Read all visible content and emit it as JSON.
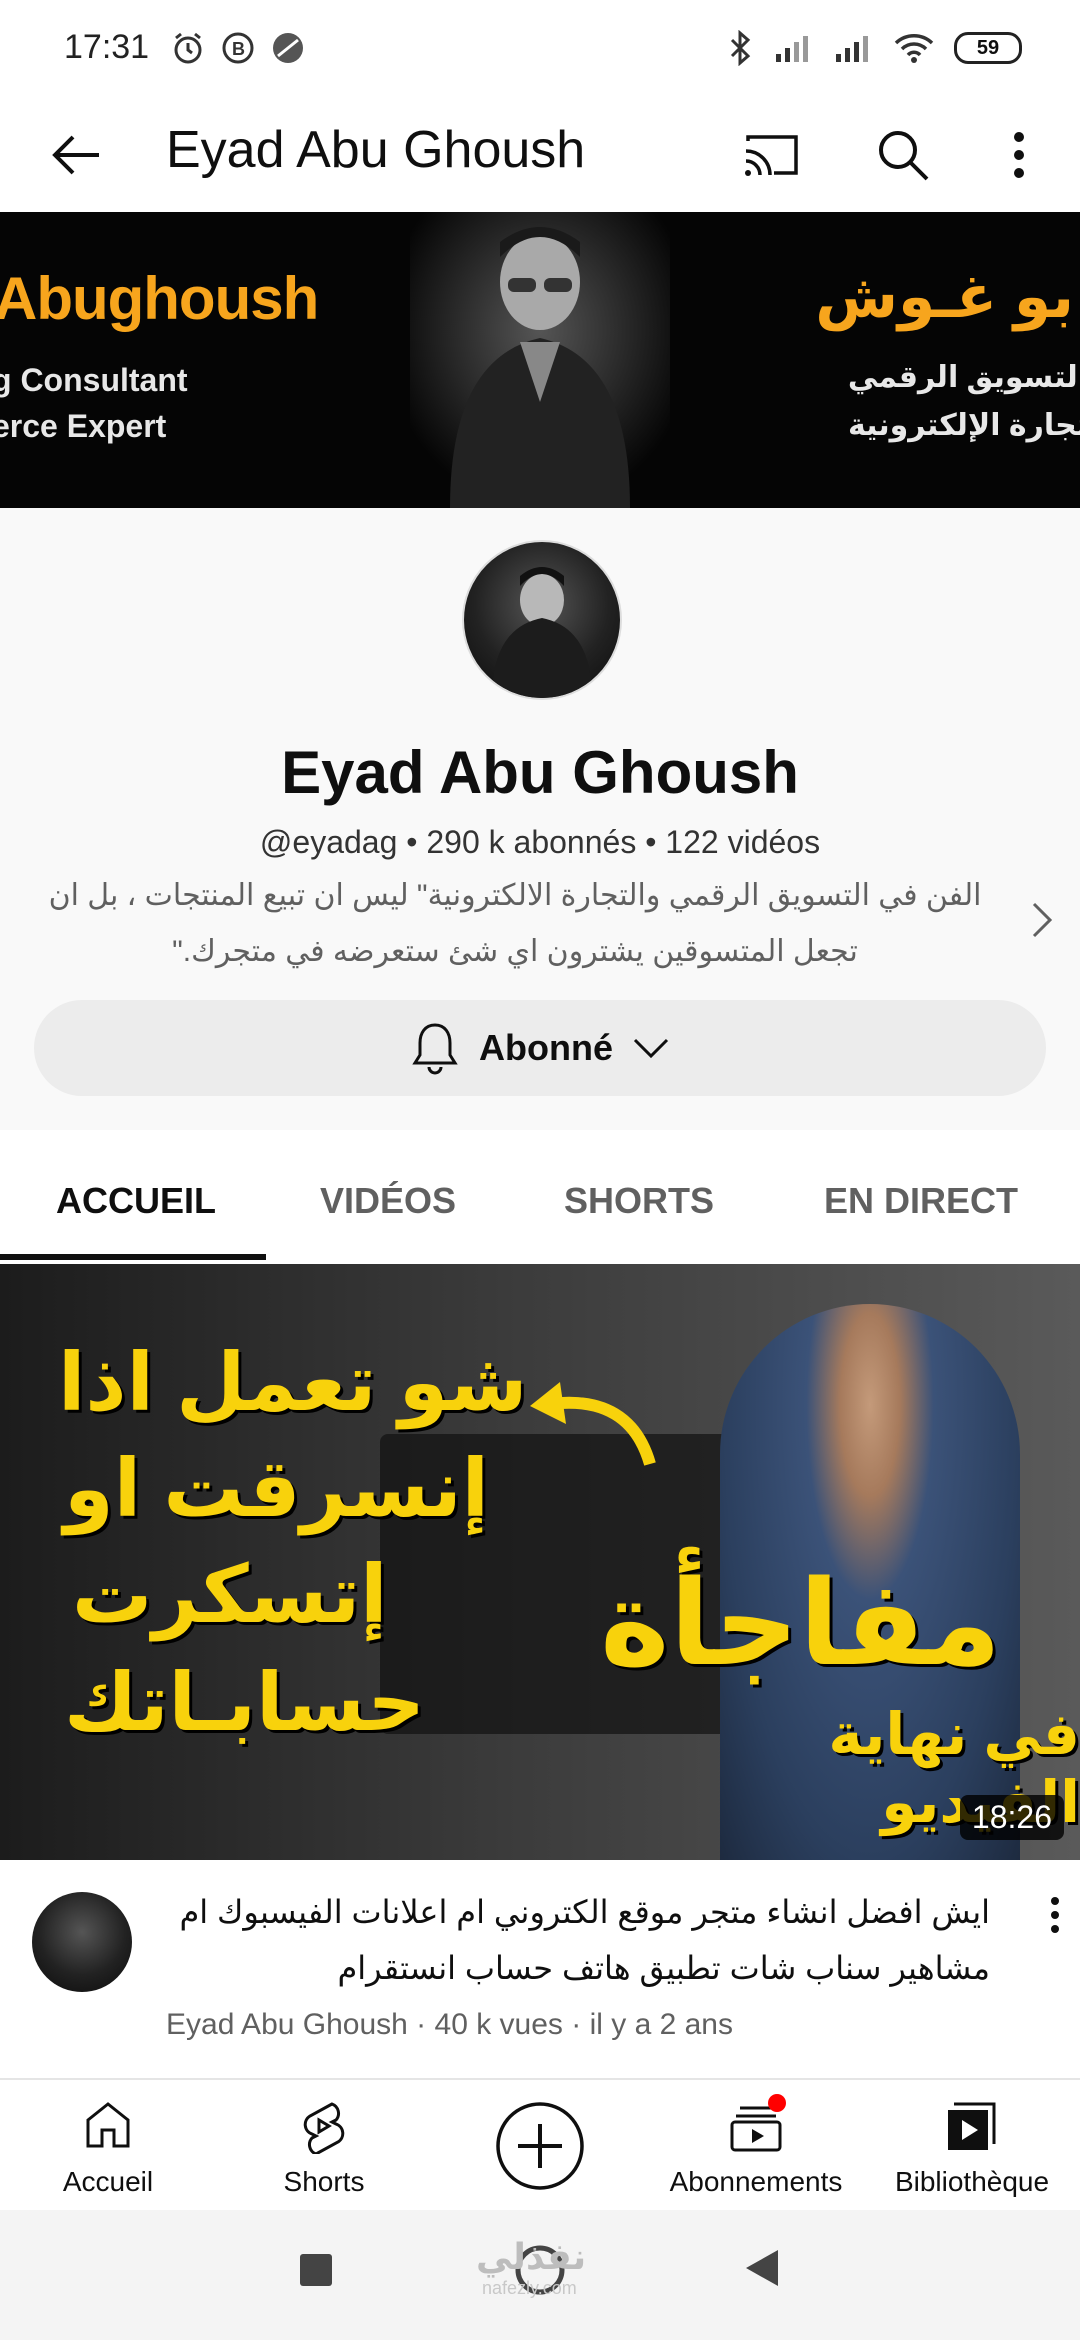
{
  "status_bar": {
    "time": "17:31",
    "battery": "59"
  },
  "top_bar": {
    "title": "Eyad Abu Ghoush"
  },
  "banner": {
    "en_name": "Abughoush",
    "en_line1": "g Consultant",
    "en_line2": "erce Expert",
    "ar_name": "بو غـوش",
    "ar_line1": "التسويق الرقمي",
    "ar_line2": "تجارة الإلكترونية"
  },
  "channel": {
    "name": "Eyad Abu Ghoush",
    "meta": "@eyadag • 290 k abonnés • 122 vidéos",
    "description": "الفن في التسويق الرقمي والتجارة الالكترونية\" ليس ان تبيع المنتجات ، بل ان تجعل المتسوقين يشترون اي شئ ستعرضه في متجرك.\"",
    "subscribe_label": "Abonné"
  },
  "tabs": [
    {
      "label": "ACCUEIL",
      "active": true
    },
    {
      "label": "VIDÉOS",
      "active": false
    },
    {
      "label": "SHORTS",
      "active": false
    },
    {
      "label": "EN DIRECT",
      "active": false
    }
  ],
  "video": {
    "thumb_text": {
      "line1": "شو تعمل اذا",
      "line2": "إنسرقت او",
      "line3": "إتسكرت",
      "line4": "حسابـاتك",
      "big": "مفاجأة",
      "small": "في نهاية الفيديو"
    },
    "duration": "18:26",
    "title": "ايش افضل انشاء متجر موقع الكتروني ام اعلانات الفيسبوك ام مشاهير سناب شات تطبيق هاتف حساب انستقرام",
    "subtitle": "Eyad Abu Ghoush · 40 k vues · il y a 2 ans"
  },
  "bottom_nav": {
    "home": "Accueil",
    "shorts": "Shorts",
    "subscriptions": "Abonnements",
    "library": "Bibliothèque"
  },
  "watermark": {
    "main": "نفذلي",
    "sub": "nafezly.com"
  },
  "colors": {
    "accent_orange": "#f7a51d",
    "thumb_yellow": "#f8d20c",
    "notification_red": "#ff0000"
  }
}
